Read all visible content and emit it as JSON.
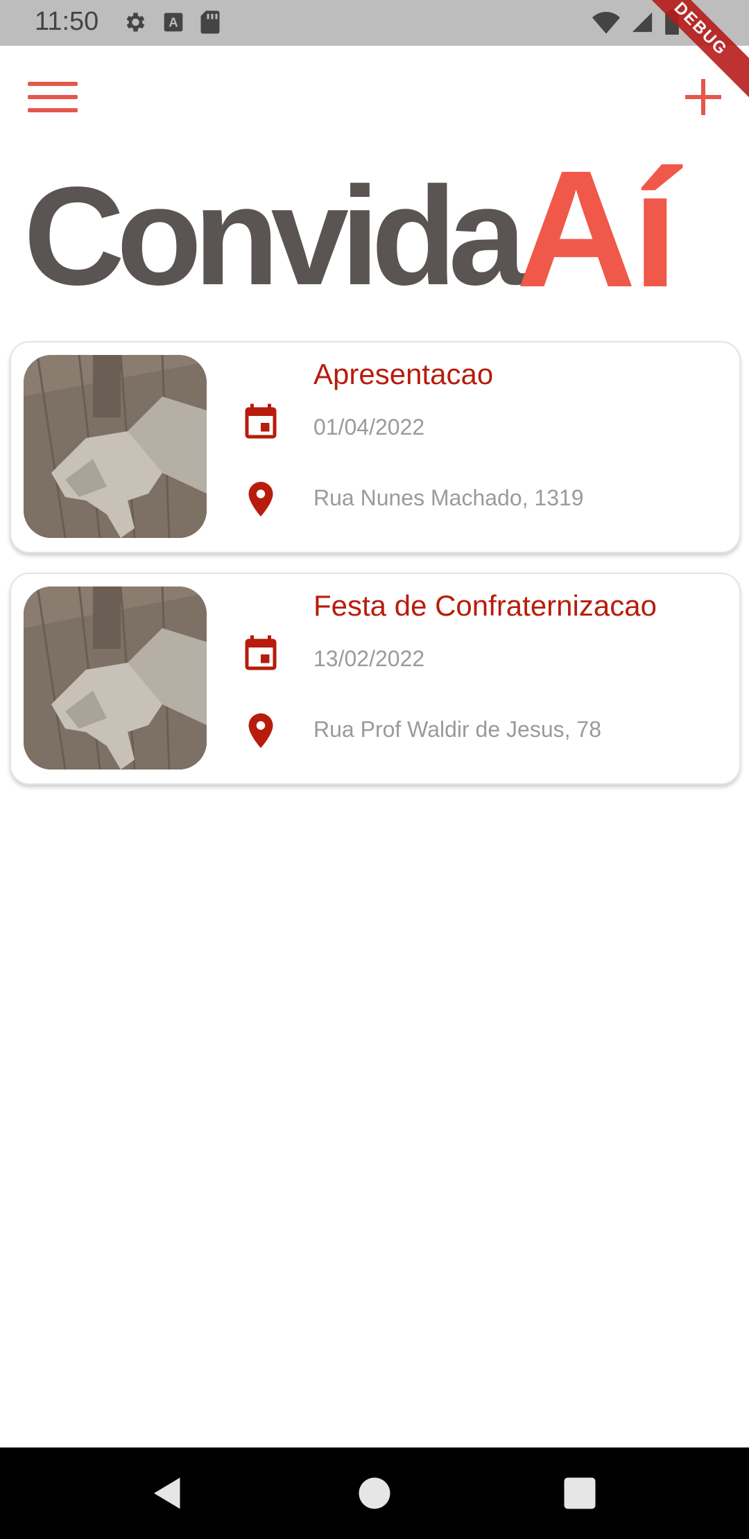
{
  "status_bar": {
    "time": "11:50",
    "icons_left": [
      "gear-icon",
      "keyboard-a-icon",
      "sd-card-icon"
    ],
    "icons_right": [
      "wifi-icon",
      "signal-icon",
      "battery-icon"
    ],
    "debug_label": "DEBUG"
  },
  "app_bar": {
    "menu_icon": "menu-icon",
    "add_icon": "plus-icon",
    "accent": "#e5574b"
  },
  "logo": {
    "word_1": "Convida",
    "word_2": "Aí",
    "color_1": "#5a5453",
    "color_2": "#f0584a"
  },
  "events": [
    {
      "title": "Apresentacao",
      "date": "01/04/2022",
      "address": "Rua Nunes Machado, 1319"
    },
    {
      "title": "Festa de Confraternizacao",
      "date": "13/02/2022",
      "address": "Rua Prof Waldir de Jesus, 78"
    }
  ],
  "colors": {
    "title": "#b71c0c",
    "icon": "#b71c0c",
    "secondary_text": "#9a9a9a"
  },
  "nav_bar": {
    "icons": [
      "back-icon",
      "home-icon",
      "recents-icon"
    ]
  }
}
